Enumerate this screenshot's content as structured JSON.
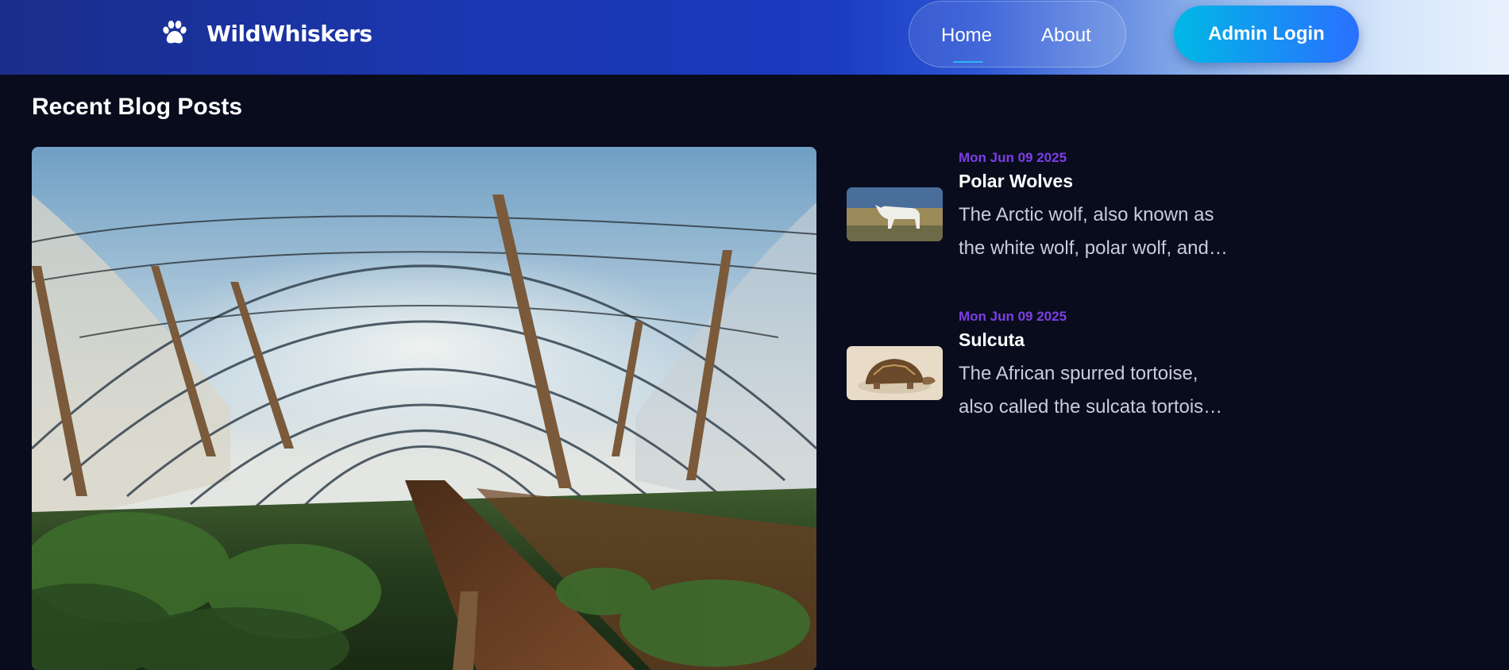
{
  "header": {
    "brand_name": "WildWhiskers",
    "brand_icon": "paw-icon",
    "nav": [
      {
        "label": "Home",
        "active": true
      },
      {
        "label": "About",
        "active": false
      }
    ],
    "admin_button_label": "Admin Login",
    "colors": {
      "accent_gradient_start": "#00b8e6",
      "accent_gradient_end": "#2a70ff",
      "active_underline": "#2fb4f0"
    }
  },
  "main": {
    "section_title": "Recent Blog Posts",
    "featured_image": "greenhouse-image",
    "posts": [
      {
        "date": "Mon Jun 09 2025",
        "title": "Polar Wolves",
        "excerpt_line1": "The Arctic wolf, also known as",
        "excerpt_line2": "the white wolf, polar wolf, and…",
        "thumbnail": "arctic-wolf-image"
      },
      {
        "date": "Mon Jun 09 2025",
        "title": "Sulcuta",
        "excerpt_line1": "The African spurred tortoise,",
        "excerpt_line2": "also called the sulcata tortois…",
        "thumbnail": "tortoise-image"
      }
    ],
    "colors": {
      "date": "#7b3fe4",
      "background": "#090c1d"
    }
  }
}
